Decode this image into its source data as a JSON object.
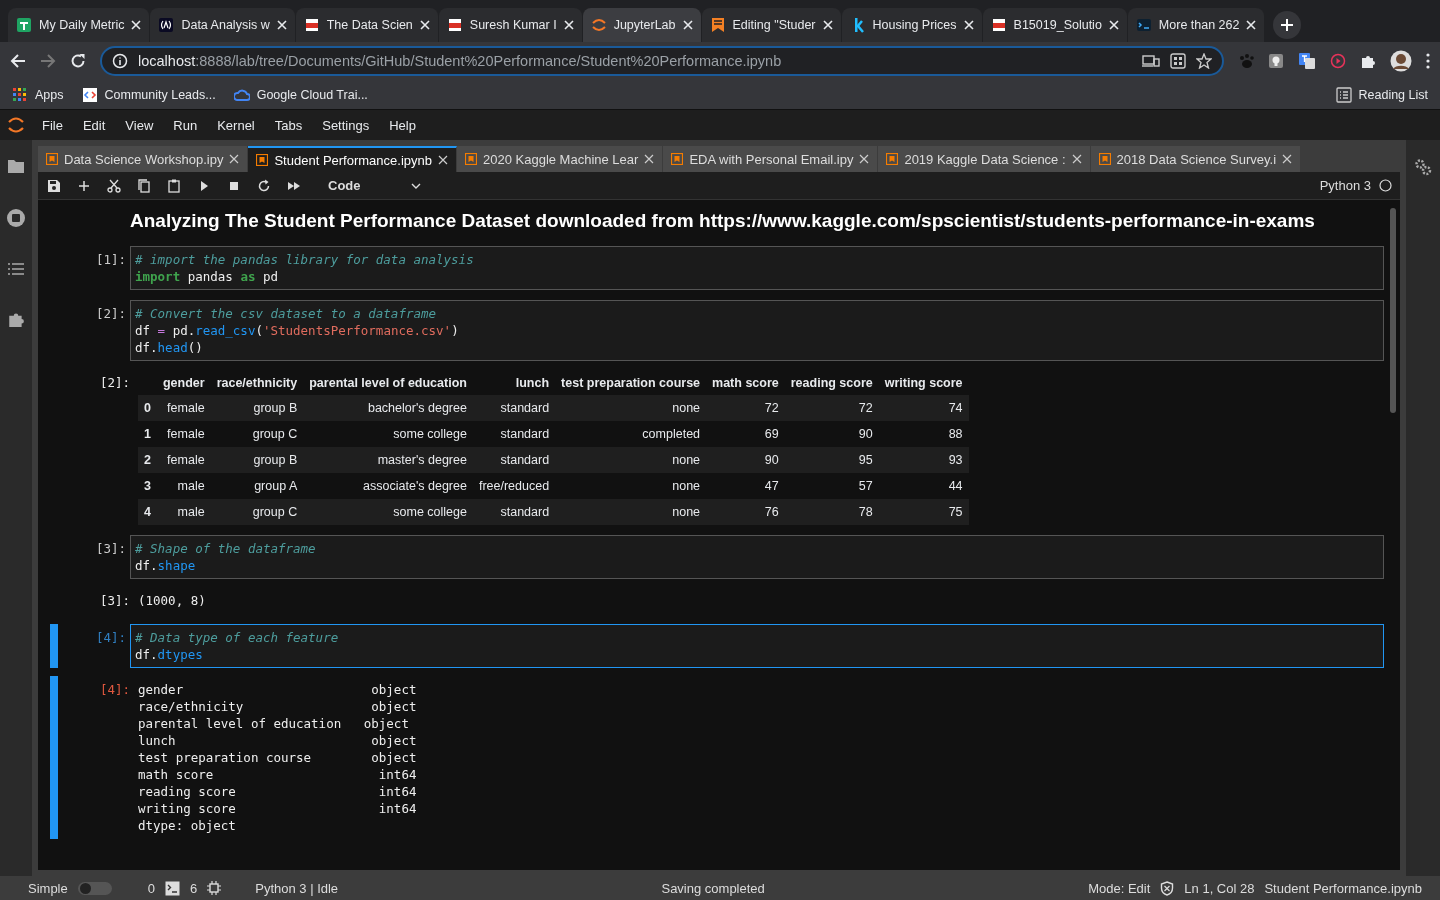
{
  "browser_tabs": [
    {
      "kind": "sheets",
      "title": "My Daily Metric",
      "selected": false
    },
    {
      "kind": "code",
      "title": "Data Analysis w",
      "selected": false
    },
    {
      "kind": "pdf",
      "title": "The Data Scien",
      "selected": false
    },
    {
      "kind": "pdf",
      "title": "Suresh Kumar I",
      "selected": false
    },
    {
      "kind": "jupyter",
      "title": "JupyterLab",
      "selected": true
    },
    {
      "kind": "bookmark",
      "title": "Editing \"Studer",
      "selected": false
    },
    {
      "kind": "letter",
      "title": "Housing Prices",
      "selected": false
    },
    {
      "kind": "pdf",
      "title": "B15019_Solutio",
      "selected": false
    },
    {
      "kind": "terminal",
      "title": "More than 262",
      "selected": false
    }
  ],
  "address_bar": {
    "host": "localhost",
    "path": ":8888/lab/tree/Documents/GitHub/Student%20Performance/Student%20Performance.ipynb"
  },
  "bookmarks": [
    {
      "kind": "apps",
      "label": "Apps"
    },
    {
      "kind": "code",
      "label": "Community Leads..."
    },
    {
      "kind": "cloud",
      "label": "Google Cloud Trai..."
    }
  ],
  "reading_list": "Reading List",
  "menu": [
    "File",
    "Edit",
    "View",
    "Run",
    "Kernel",
    "Tabs",
    "Settings",
    "Help"
  ],
  "notebook_tabs": [
    {
      "title": "Data Science Workshop.ipy",
      "selected": false
    },
    {
      "title": "Student Performance.ipynb",
      "selected": true
    },
    {
      "title": "2020 Kaggle Machine Lear",
      "selected": false
    },
    {
      "title": "EDA with Personal Email.ipy",
      "selected": false
    },
    {
      "title": "2019 Kaggle Data Science :",
      "selected": false
    },
    {
      "title": "2018 Data Science Survey.i",
      "selected": false
    }
  ],
  "toolbar": {
    "cell_type": "Code",
    "kernel": "Python 3"
  },
  "cells": [
    {
      "kind": "markdown",
      "heading": "Analyzing The Student Performance Dataset downloaded from https://www.kaggle.com/spscientist/students-performance-in-exams"
    },
    {
      "kind": "code",
      "prompt": "[1]:",
      "selected": false,
      "lines": [
        [
          {
            "kind": "comment",
            "s": "# import the pandas library for data analysis"
          }
        ],
        [
          {
            "kind": "keyword",
            "s": "import"
          },
          {
            "kind": "plain",
            "s": " pandas "
          },
          {
            "kind": "keyword",
            "s": "as"
          },
          {
            "kind": "plain",
            "s": " pd"
          }
        ]
      ]
    },
    {
      "kind": "code",
      "prompt": "[2]:",
      "selected": false,
      "lines": [
        [
          {
            "kind": "comment",
            "s": "# Convert the csv dataset to a dataframe"
          }
        ],
        [
          {
            "kind": "plain",
            "s": "df "
          },
          {
            "kind": "operator",
            "s": "="
          },
          {
            "kind": "plain",
            "s": " pd."
          },
          {
            "kind": "function",
            "s": "read_csv"
          },
          {
            "kind": "plain",
            "s": "("
          },
          {
            "kind": "string",
            "s": "'StudentsPerformance.csv'"
          },
          {
            "kind": "plain",
            "s": ")"
          }
        ],
        [
          {
            "kind": "plain",
            "s": "df."
          },
          {
            "kind": "function",
            "s": "head"
          },
          {
            "kind": "plain",
            "s": "()"
          }
        ]
      ],
      "output": {
        "kind": "table",
        "prompt": "[2]:",
        "columns": [
          "gender",
          "race/ethnicity",
          "parental level of education",
          "lunch",
          "test preparation course",
          "math score",
          "reading score",
          "writing score"
        ],
        "rows": [
          {
            "index": "0",
            "cells": [
              "female",
              "group B",
              "bachelor's degree",
              "standard",
              "none",
              "72",
              "72",
              "74"
            ]
          },
          {
            "index": "1",
            "cells": [
              "female",
              "group C",
              "some college",
              "standard",
              "completed",
              "69",
              "90",
              "88"
            ]
          },
          {
            "index": "2",
            "cells": [
              "female",
              "group B",
              "master's degree",
              "standard",
              "none",
              "90",
              "95",
              "93"
            ]
          },
          {
            "index": "3",
            "cells": [
              "male",
              "group A",
              "associate's degree",
              "free/reduced",
              "none",
              "47",
              "57",
              "44"
            ]
          },
          {
            "index": "4",
            "cells": [
              "male",
              "group C",
              "some college",
              "standard",
              "none",
              "76",
              "78",
              "75"
            ]
          }
        ]
      }
    },
    {
      "kind": "code",
      "prompt": "[3]:",
      "selected": false,
      "lines": [
        [
          {
            "kind": "comment",
            "s": "# Shape of the dataframe"
          }
        ],
        [
          {
            "kind": "plain",
            "s": "df."
          },
          {
            "kind": "function",
            "s": "shape"
          }
        ]
      ],
      "output": {
        "kind": "text",
        "prompt": "[3]:",
        "lines": [
          "(1000, 8)"
        ]
      }
    },
    {
      "kind": "code",
      "prompt": "[4]:",
      "selected": true,
      "lines": [
        [
          {
            "kind": "comment",
            "s": "# Data type of each feature"
          }
        ],
        [
          {
            "kind": "plain",
            "s": "df."
          },
          {
            "kind": "function",
            "s": "dtypes"
          }
        ]
      ],
      "output": {
        "kind": "text",
        "prompt": "[4]:",
        "lines": [
          "gender                         object",
          "race/ethnicity                 object",
          "parental level of education   object",
          "lunch                          object",
          "test preparation course        object",
          "math score                      int64",
          "reading score                   int64",
          "writing score                   int64",
          "dtype: object"
        ]
      }
    }
  ],
  "status_bar": {
    "simple_label": "Simple",
    "simple_mode": false,
    "terminals": "0",
    "kernels": "6",
    "kernel_status": "Python 3 | Idle",
    "message": "Saving completed",
    "mode": "Mode: Edit",
    "cursor": "Ln 1, Col 28",
    "file": "Student Performance.ipynb"
  }
}
